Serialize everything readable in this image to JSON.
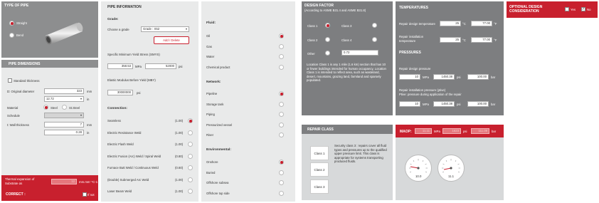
{
  "type_of_pipe": {
    "title": "TYPE OF PIPE",
    "straight": "Straight",
    "bend": "Bend"
  },
  "pipe_dimensions": {
    "title": "PIPE DIMENSIONS",
    "standard_thickness": "Standard thickness",
    "original_diameter_label": "D: Original diameter",
    "diameter_mm": "323",
    "diameter_mm_unit": "mm",
    "diameter_in": "12.72",
    "diameter_in_unit": "in",
    "material_label": "Material",
    "steel": "Steel",
    "st_steel": "St.Steel",
    "schedule_label": "Schedule",
    "wall_thickness_label": "t: Wall thickness",
    "wall_mm": "7",
    "wall_mm_unit": "mm",
    "wall_in": "0.28",
    "wall_in_unit": "in"
  },
  "thermal": {
    "label": "Thermal expansion of Substrate αs",
    "value": "12",
    "unit": "mm.mm⁻¹C-1"
  },
  "correct": {
    "label": "CORRECT :",
    "if_not": "If not"
  },
  "pipe_information": {
    "title": "PIPE INFORMATION",
    "grade_label": "Grade:",
    "choose_grade": "Choose a grade",
    "grade_value": "Grade : X52",
    "add_delete": "Add / Delete",
    "smys_label": "Specific Minimum Yield Stress (SMYS)",
    "smys_mpa": "358.53",
    "mpa": "MPa",
    "smys_psi": "52000",
    "psi": "psi",
    "mby_label": "Elastic Modulus Before Yield (MBY)",
    "mby_value": "30000000",
    "mby_unit": "psi"
  },
  "connection": {
    "title": "Connection:",
    "items": [
      {
        "label": "Seamless",
        "factor": "(1.00)",
        "on": true
      },
      {
        "label": "Electric Resistance Weld",
        "factor": "(1.00)",
        "on": false
      },
      {
        "label": "Electric Flash Weld",
        "factor": "(1.00)",
        "on": false
      },
      {
        "label": "Electric Fusion (Arc) Weld / Spiral Weld",
        "factor": "(0.80)",
        "on": false
      },
      {
        "label": "Furnace Butt Weld / Continuous Weld",
        "factor": "(0.60)",
        "on": false
      },
      {
        "label": "(Double) Submerged Arc Weld",
        "factor": "(1.00)",
        "on": false
      },
      {
        "label": "Laser Beam Weld",
        "factor": "(1.00)",
        "on": false
      }
    ]
  },
  "fluid": {
    "title": "Fluid:",
    "items": [
      {
        "label": "Oil",
        "on": true
      },
      {
        "label": "Gas",
        "on": false
      },
      {
        "label": "Water",
        "on": false
      },
      {
        "label": "Chemical product",
        "on": false
      }
    ]
  },
  "network": {
    "title": "Network:",
    "items": [
      {
        "label": "Pipeline",
        "on": true
      },
      {
        "label": "Storage tank",
        "on": false
      },
      {
        "label": "Piping",
        "on": false
      },
      {
        "label": "Pressurized vessel",
        "on": false
      },
      {
        "label": "Riser",
        "on": false
      }
    ]
  },
  "environmental": {
    "title": "Environmental:",
    "items": [
      {
        "label": "Onshore",
        "on": true
      },
      {
        "label": "Buried",
        "on": false
      },
      {
        "label": "Offshore subsea",
        "on": false
      },
      {
        "label": "Offshore top side",
        "on": false
      }
    ]
  },
  "design_factor": {
    "title": "DESIGN FACTOR",
    "subtitle": "(According to ASME B31.4 and ASME B31.8)",
    "class1": "Class 1",
    "class3": "Class 3",
    "class2": "Class 2",
    "class4": "Class 4",
    "other": "Other",
    "other_value": "0.72",
    "description": "Location Class 1 is any 1 mile (1.6 km) section that has 10 or fewer buildings intended for human occupancy. Location Class 1 is intended to reflect area, such as wasteland, desert, mountains, grazing land, farmland and sparsely populated."
  },
  "repair_class": {
    "title": "REPAIR CLASS",
    "class1": "Class 1",
    "class2": "Class 2",
    "class3": "Class 3",
    "description": "Security class 3 : repairs cover all fluid types and pressures up to the qualified upper pressure limit. This class is appropriate for systems transporting produced fluids."
  },
  "temperatures": {
    "title": "TEMPERATURES",
    "design_label": "Repair design temperature",
    "design_c": "25",
    "c_unit": "°C",
    "design_f": "77.00",
    "f_unit": "°F",
    "install_label": "Repair installation temperature",
    "install_c": "25",
    "install_f": "77.00"
  },
  "pressures": {
    "title": "PRESSURES",
    "design_label": "Repair design pressure",
    "design_mpa": "10",
    "mpa": "MPa",
    "design_psi": "1450.38",
    "psi": "psi",
    "design_bar": "100.00",
    "bar": "bar",
    "install_label": "Repair installation pressure (ptive)",
    "install_note": "Ptive: pressure during application of the repair",
    "install_mpa": "10",
    "install_psi": "1450.38",
    "install_bar": "100.00"
  },
  "maop": {
    "label": "MAOP:",
    "mpa_value": "11.11",
    "mpa": "MPa",
    "psi_value": "1623",
    "psi": "psi",
    "bar_value": "111.09",
    "bar": "bar"
  },
  "gauges": [
    {
      "value": "10.0"
    },
    {
      "value": "11.1"
    }
  ],
  "optional": {
    "title": "OPTIONAL DESIGN CONSIDERATION",
    "yes": "Yes",
    "no": "No"
  }
}
